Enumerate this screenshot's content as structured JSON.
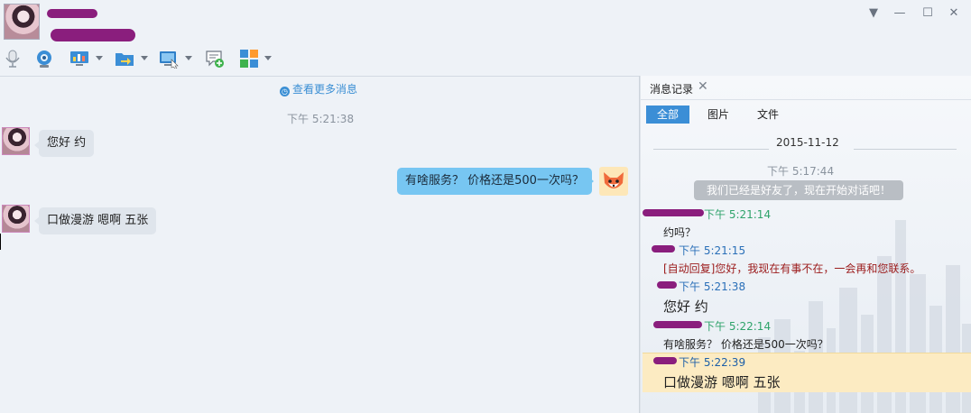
{
  "window": {
    "controls": [
      {
        "name": "menu-dropdown",
        "glyph": "▼"
      },
      {
        "name": "minimize",
        "glyph": "—"
      },
      {
        "name": "maximize",
        "glyph": "☐"
      },
      {
        "name": "close",
        "glyph": "✕"
      }
    ]
  },
  "toolbar": {
    "icons": [
      "microphone-icon",
      "webcam-icon",
      "screen-share-icon",
      "file-transfer-icon",
      "remote-desktop-icon",
      "chat-add-icon",
      "apps-grid-icon"
    ]
  },
  "chat": {
    "more_messages": "查看更多消息",
    "timestamp": "下午 5:21:38",
    "messages": [
      {
        "direction": "incoming",
        "text": "您好 约"
      },
      {
        "direction": "outgoing",
        "text": "有啥服务？ 价格还是500一次吗？"
      },
      {
        "direction": "incoming",
        "text": "口做漫游 嗯啊 五张"
      }
    ]
  },
  "history": {
    "tab_label": "消息记录",
    "close_glyph": "✕",
    "filters": {
      "all": "全部",
      "images": "图片",
      "files": "文件"
    },
    "date": "2015-11-12",
    "system_time": "下午 5:17:44",
    "system_message": "我们已经是好友了，现在开始对话吧！",
    "entries": [
      {
        "time": "下午 5:21:14",
        "text": "约吗？"
      },
      {
        "time": "下午 5:21:15",
        "text": "[自动回复]您好，我现在有事不在，一会再和您联系。"
      },
      {
        "time": "下午 5:21:38",
        "text": "您好 约"
      },
      {
        "time": "下午 5:22:14",
        "text": "有啥服务？ 价格还是500一次吗？"
      },
      {
        "time": "下午 5:22:39",
        "text": "口做漫游 嗯啊 五张"
      }
    ]
  },
  "colors": {
    "accent": "#3b8ed6",
    "incoming_bubble": "#dfe5ec",
    "outgoing_bubble": "#77c6f2",
    "highlight": "#fcebc2",
    "redaction": "#8a1e7d"
  }
}
